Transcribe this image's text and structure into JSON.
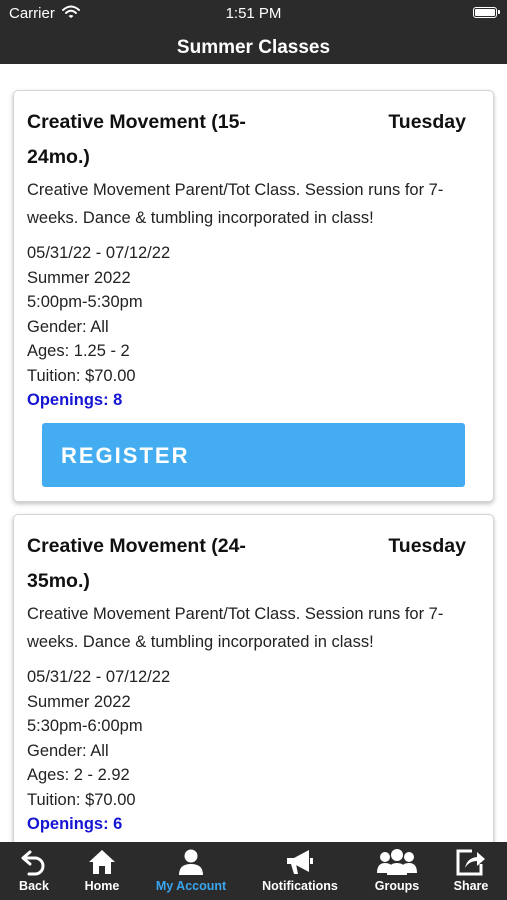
{
  "status_bar": {
    "carrier": "Carrier",
    "time": "1:51 PM"
  },
  "header": {
    "title": "Summer Classes"
  },
  "classes": [
    {
      "title": "Creative Movement (15-24mo.)",
      "day": "Tuesday",
      "description": "Creative Movement Parent/Tot Class. Session runs for 7-weeks. Dance & tumbling incorporated in class!",
      "dates": "05/31/22 - 07/12/22",
      "session": "Summer 2022",
      "time": "5:00pm-5:30pm",
      "gender": "Gender: All",
      "ages": "Ages: 1.25 - 2",
      "tuition": "Tuition: $70.00",
      "openings": "Openings: 8",
      "register_label": "REGISTER"
    },
    {
      "title": "Creative Movement (24-35mo.)",
      "day": "Tuesday",
      "description": "Creative Movement Parent/Tot Class. Session runs for 7-weeks. Dance & tumbling incorporated in class!",
      "dates": "05/31/22 - 07/12/22",
      "session": "Summer 2022",
      "time": "5:30pm-6:00pm",
      "gender": "Gender: All",
      "ages": "Ages: 2 - 2.92",
      "tuition": "Tuition: $70.00",
      "openings": "Openings: 6"
    }
  ],
  "tab_bar": {
    "active_color": "#3aa5f0",
    "tabs": [
      {
        "label": "Back",
        "icon": "back-arrow-icon"
      },
      {
        "label": "Home",
        "icon": "home-icon"
      },
      {
        "label": "My Account",
        "icon": "person-icon"
      },
      {
        "label": "Notifications",
        "icon": "megaphone-icon"
      },
      {
        "label": "Groups",
        "icon": "group-icon"
      },
      {
        "label": "Share",
        "icon": "share-icon"
      }
    ]
  }
}
